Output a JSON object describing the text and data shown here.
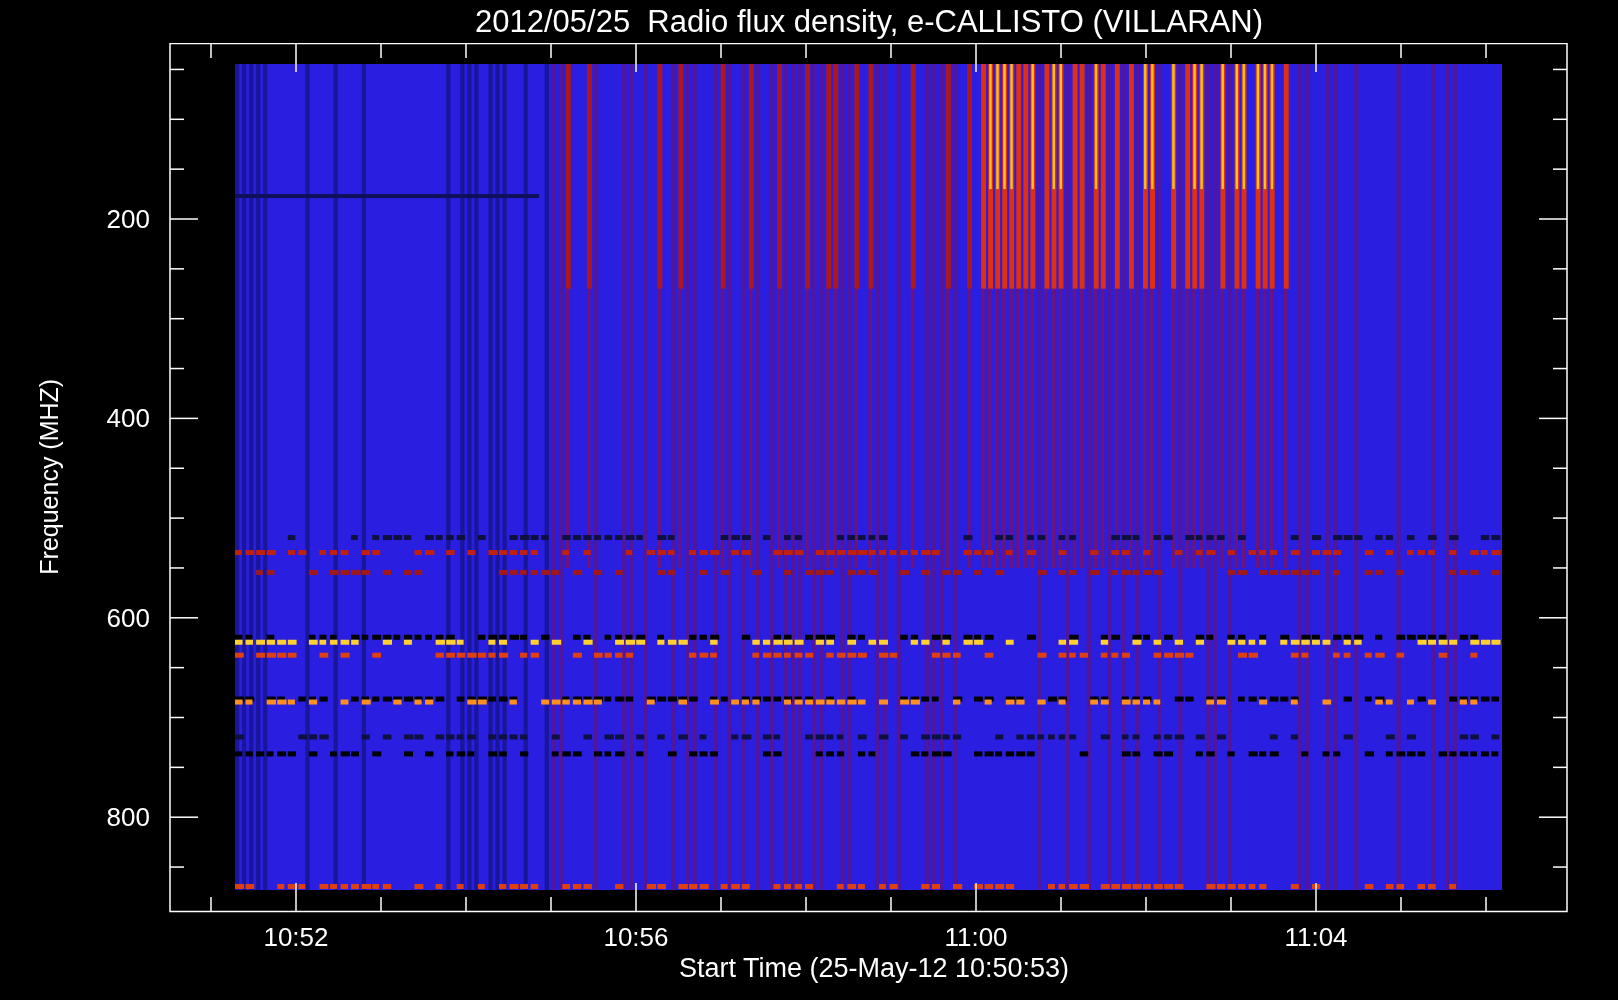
{
  "title": "2012/05/25  Radio flux density, e-CALLISTO (VILLARAN)",
  "y_axis": {
    "label": "Frequency (MHZ)",
    "ticks": [
      "200",
      "400",
      "600",
      "800"
    ]
  },
  "x_axis": {
    "label": "Start Time (25-May-12 10:50:53)",
    "ticks": [
      "10:52",
      "10:56",
      "11:00",
      "11:04"
    ]
  }
}
